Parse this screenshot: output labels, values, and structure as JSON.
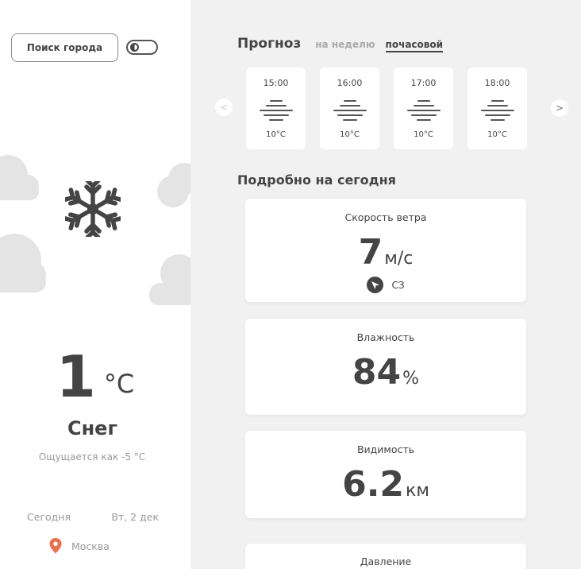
{
  "app": {
    "search_button": "Поиск города",
    "theme_toggle_icon": "half-moon-icon"
  },
  "current": {
    "icon": "snowflake-icon",
    "temperature": "1",
    "unit": "°C",
    "condition": "Снег",
    "feels_like": "Ощущается как -5 °C",
    "day_label": "Сегодня",
    "date": "Вт, 2 дек",
    "location_icon": "location-pin-icon",
    "city": "Москва"
  },
  "forecast": {
    "title": "Прогноз",
    "tabs": [
      {
        "label": "на неделю",
        "active": false
      },
      {
        "label": "почасовой",
        "active": true
      }
    ],
    "prev_arrow": "<",
    "next_arrow": ">",
    "hours": [
      {
        "time": "15:00",
        "icon": "fog-icon",
        "temp": "10°C"
      },
      {
        "time": "16:00",
        "icon": "fog-icon",
        "temp": "10°C"
      },
      {
        "time": "17:00",
        "icon": "fog-icon",
        "temp": "10°C"
      },
      {
        "time": "18:00",
        "icon": "fog-icon",
        "temp": "10°C"
      }
    ]
  },
  "details": {
    "title": "Подробно на сегодня",
    "wind": {
      "label": "Скорость ветра",
      "value": "7",
      "unit": "м/с",
      "direction": "СЗ",
      "direction_icon": "compass-arrow-icon"
    },
    "humidity": {
      "label": "Влажность",
      "value": "84",
      "unit": "%"
    },
    "visibility": {
      "label": "Видимость",
      "value": "6.2",
      "unit": "км"
    },
    "pressure": {
      "label": "Давление"
    }
  },
  "colors": {
    "background": "#f1f1f1",
    "panel": "#ffffff",
    "text": "#444444",
    "muted": "#999999",
    "cloud": "#e4e4e4",
    "pin": "#e8704f"
  }
}
